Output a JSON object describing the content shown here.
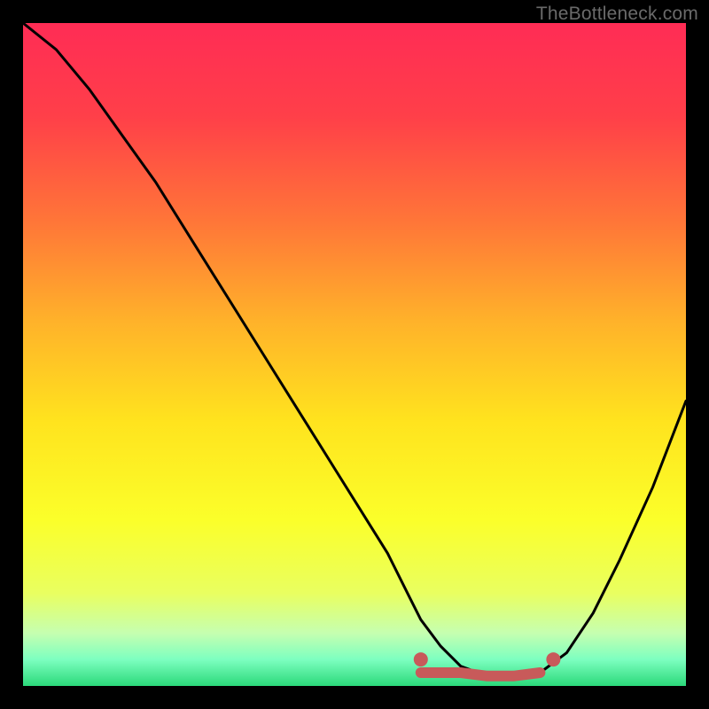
{
  "watermark": "TheBottleneck.com",
  "chart_data": {
    "type": "line",
    "title": "",
    "xlabel": "",
    "ylabel": "",
    "xlim": [
      0,
      100
    ],
    "ylim": [
      0,
      100
    ],
    "grid": false,
    "legend": false,
    "series": [
      {
        "name": "bottleneck-curve",
        "x": [
          0,
          5,
          10,
          15,
          20,
          25,
          30,
          35,
          40,
          45,
          50,
          55,
          58,
          60,
          63,
          66,
          70,
          74,
          78,
          82,
          86,
          90,
          95,
          100
        ],
        "y": [
          100,
          96,
          90,
          83,
          76,
          68,
          60,
          52,
          44,
          36,
          28,
          20,
          14,
          10,
          6,
          3,
          1.5,
          1.5,
          2,
          5,
          11,
          19,
          30,
          43
        ]
      }
    ],
    "markers": [
      {
        "name": "marker-left-end",
        "x": 60,
        "y": 4
      },
      {
        "name": "marker-right-end",
        "x": 80,
        "y": 4
      }
    ],
    "thick_segment": {
      "x0": 60,
      "x1": 80,
      "y": 2
    },
    "gradient_stops": [
      {
        "offset": 0,
        "color": "#ff2c55"
      },
      {
        "offset": 14,
        "color": "#ff3f49"
      },
      {
        "offset": 30,
        "color": "#ff7638"
      },
      {
        "offset": 45,
        "color": "#ffb22a"
      },
      {
        "offset": 60,
        "color": "#ffe31e"
      },
      {
        "offset": 75,
        "color": "#fbff2a"
      },
      {
        "offset": 86,
        "color": "#e9ff60"
      },
      {
        "offset": 92,
        "color": "#c6ffb0"
      },
      {
        "offset": 96,
        "color": "#7dffc0"
      },
      {
        "offset": 100,
        "color": "#2bd97a"
      }
    ],
    "marker_color": "#c85a5a",
    "curve_color": "#000000"
  }
}
